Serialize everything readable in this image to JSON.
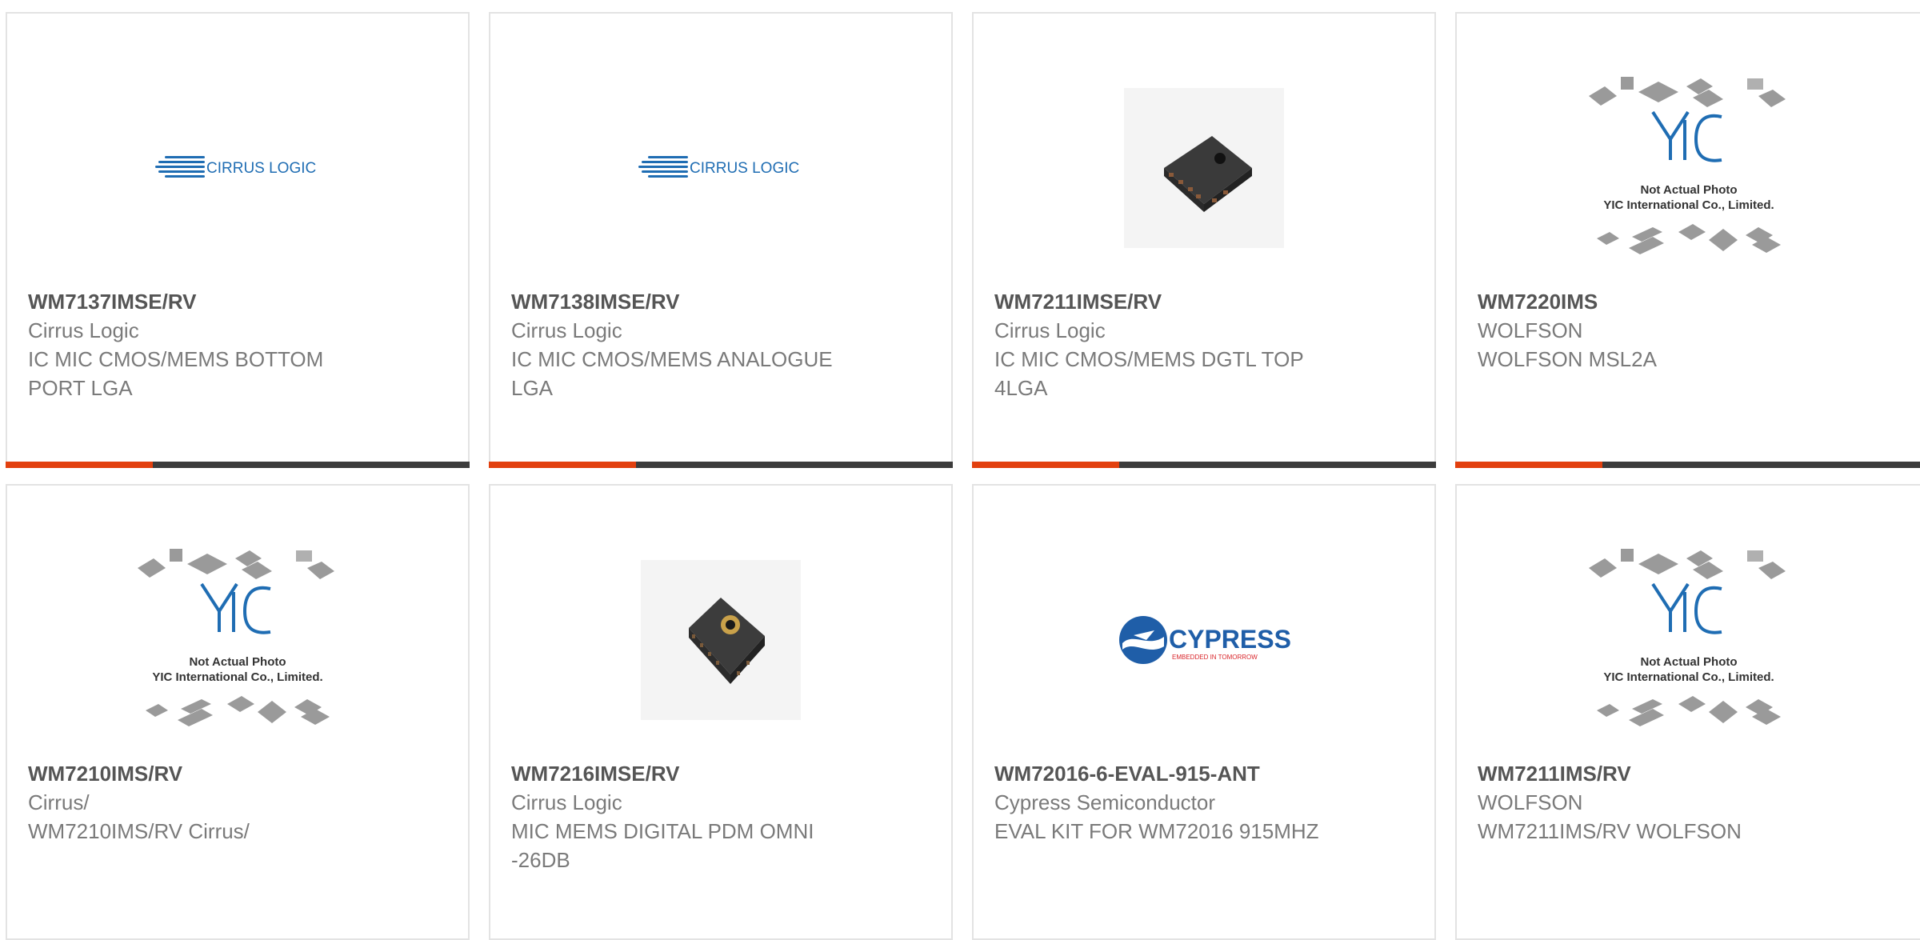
{
  "cards": [
    {
      "part": "WM7137IMSE/RV",
      "manufacturer": "Cirrus Logic",
      "description": "IC MIC CMOS/MEMS BOTTOM PORT LGA",
      "image": "cirrus-logic-logo",
      "logo_text": "CIRRUS LOGIC"
    },
    {
      "part": "WM7138IMSE/RV",
      "manufacturer": "Cirrus Logic",
      "description": "IC MIC CMOS/MEMS ANALOGUE LGA",
      "image": "cirrus-logic-logo",
      "logo_text": "CIRRUS LOGIC"
    },
    {
      "part": "WM7211IMSE/RV",
      "manufacturer": "Cirrus Logic",
      "description": "IC MIC CMOS/MEMS DGTL TOP 4LGA",
      "image": "mems-chip-photo"
    },
    {
      "part": "WM7220IMS",
      "manufacturer": "WOLFSON",
      "description": "WOLFSON MSL2A",
      "image": "yic-placeholder",
      "placeholder_line1": "Not Actual Photo",
      "placeholder_line2": "YIC International Co., Limited."
    },
    {
      "part": "WM7210IMS/RV",
      "manufacturer": "Cirrus/",
      "description": "WM7210IMS/RV Cirrus/",
      "image": "yic-placeholder",
      "placeholder_line1": "Not Actual Photo",
      "placeholder_line2": "YIC International Co., Limited."
    },
    {
      "part": "WM7216IMSE/RV",
      "manufacturer": "Cirrus Logic",
      "description": "MIC MEMS DIGITAL PDM OMNI -26DB",
      "image": "mems-chip-port-photo"
    },
    {
      "part": "WM72016-6-EVAL-915-ANT",
      "manufacturer": "Cypress Semiconductor",
      "description": "EVAL KIT FOR WM72016 915MHZ",
      "image": "cypress-logo",
      "logo_text": "CYPRESS",
      "logo_tagline": "EMBEDDED IN TOMORROW"
    },
    {
      "part": "WM7211IMS/RV",
      "manufacturer": "WOLFSON",
      "description": "WM7211IMS/RV WOLFSON",
      "image": "yic-placeholder",
      "placeholder_line1": "Not Actual Photo",
      "placeholder_line2": "YIC International Co., Limited."
    }
  ],
  "colors": {
    "accent": "#e2400f",
    "bar": "#3c3c3c",
    "cirrus_blue": "#1f6db3",
    "cypress_blue": "#1f5ea8",
    "cypress_red": "#d9262b"
  }
}
